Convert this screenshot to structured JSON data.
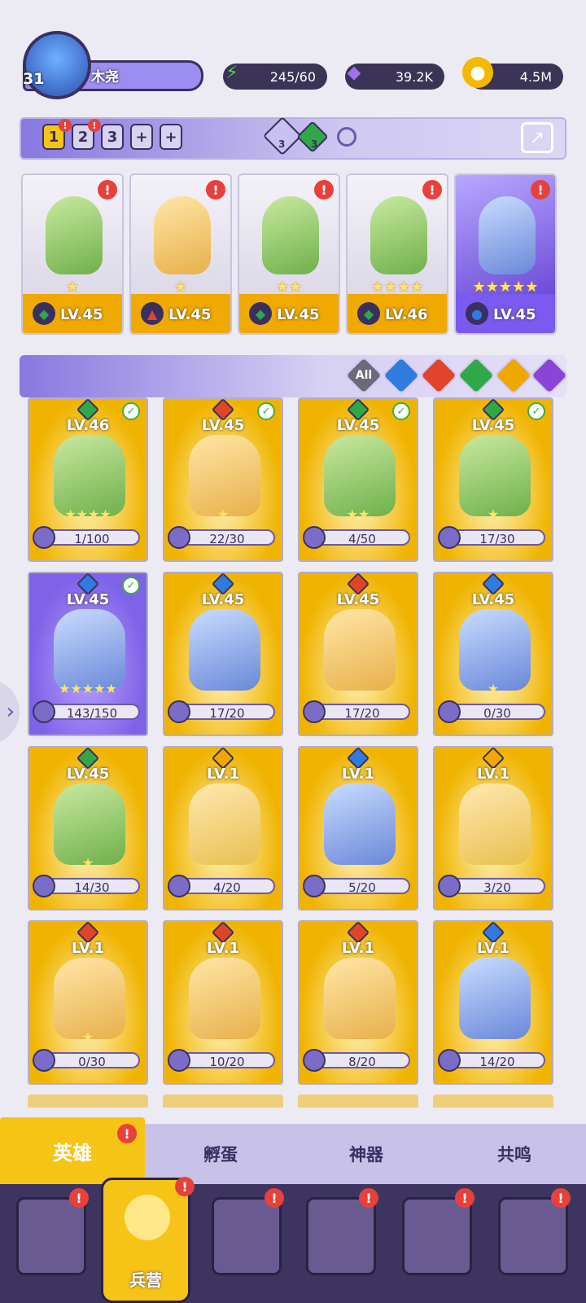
{
  "player": {
    "level": "31",
    "name": "木尧"
  },
  "resources": [
    {
      "name": "energy",
      "icon": "lightning-icon",
      "value": "245/60",
      "color": "#5cd040"
    },
    {
      "name": "gems",
      "icon": "gem-icon",
      "value": "39.2K",
      "color": "#a070f0"
    },
    {
      "name": "gold",
      "icon": "coin-icon",
      "value": "4.5M",
      "color": "#f4b800"
    }
  ],
  "team_slots": [
    "1",
    "2",
    "3",
    "+",
    "+"
  ],
  "team_counts": {
    "light": "3",
    "nature": "3"
  },
  "team_heroes": [
    {
      "level": "LV.45",
      "stars": "★",
      "element": "nature",
      "rare": false
    },
    {
      "level": "LV.45",
      "stars": "★",
      "element": "fire",
      "rare": false
    },
    {
      "level": "LV.45",
      "stars": "★★",
      "element": "nature",
      "rare": false
    },
    {
      "level": "LV.46",
      "stars": "★★★★",
      "element": "nature",
      "rare": false
    },
    {
      "level": "LV.45",
      "stars": "★★★★★",
      "element": "water",
      "rare": true
    }
  ],
  "filters": [
    "All",
    "water",
    "fire",
    "nature",
    "light",
    "dark"
  ],
  "heroes": [
    {
      "level": "LV.46",
      "progress": "1/100",
      "element": "nature",
      "check": true,
      "stars": "★★★★",
      "rare": false
    },
    {
      "level": "LV.45",
      "progress": "22/30",
      "element": "fire",
      "check": true,
      "stars": "★",
      "rare": false
    },
    {
      "level": "LV.45",
      "progress": "4/50",
      "element": "nature",
      "check": true,
      "stars": "★★",
      "rare": false
    },
    {
      "level": "LV.45",
      "progress": "17/30",
      "element": "nature",
      "check": true,
      "stars": "★",
      "rare": false
    },
    {
      "level": "LV.45",
      "progress": "143/150",
      "element": "water",
      "check": true,
      "stars": "★★★★★",
      "rare": true
    },
    {
      "level": "LV.45",
      "progress": "17/20",
      "element": "water",
      "check": false,
      "stars": "",
      "rare": false
    },
    {
      "level": "LV.45",
      "progress": "17/20",
      "element": "fire",
      "check": false,
      "stars": "",
      "rare": false
    },
    {
      "level": "LV.45",
      "progress": "0/30",
      "element": "water",
      "check": false,
      "stars": "★",
      "rare": false
    },
    {
      "level": "LV.45",
      "progress": "14/30",
      "element": "nature",
      "check": false,
      "stars": "★",
      "rare": false
    },
    {
      "level": "LV.1",
      "progress": "4/20",
      "element": "light",
      "check": false,
      "stars": "",
      "rare": false
    },
    {
      "level": "LV.1",
      "progress": "5/20",
      "element": "water",
      "check": false,
      "stars": "",
      "rare": false
    },
    {
      "level": "LV.1",
      "progress": "3/20",
      "element": "light",
      "check": false,
      "stars": "",
      "rare": false
    },
    {
      "level": "LV.1",
      "progress": "0/30",
      "element": "fire",
      "check": false,
      "stars": "★",
      "rare": false
    },
    {
      "level": "LV.1",
      "progress": "10/20",
      "element": "fire",
      "check": false,
      "stars": "",
      "rare": false
    },
    {
      "level": "LV.1",
      "progress": "8/20",
      "element": "fire",
      "check": false,
      "stars": "",
      "rare": false
    },
    {
      "level": "LV.1",
      "progress": "14/20",
      "element": "water",
      "check": false,
      "stars": "",
      "rare": false
    }
  ],
  "sub_tabs": [
    "英雄",
    "孵蛋",
    "神器",
    "共鸣"
  ],
  "nav": {
    "active_label": "兵营"
  },
  "colors": {
    "nature": "#2fa84a",
    "fire": "#e0452a",
    "water": "#2f7be0",
    "light": "#f0a800",
    "dark": "#8a44d8"
  }
}
